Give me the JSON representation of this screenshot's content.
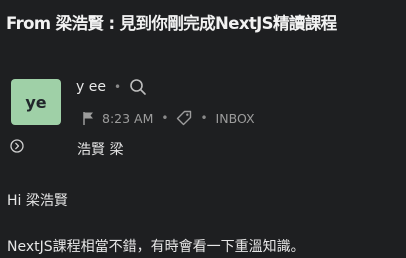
{
  "email": {
    "subject": "From 梁浩賢 : 見到你剛完成NextJS精讀課程",
    "avatar_initials": "ye",
    "avatar_color": "#9fd0a7",
    "sender_name": "y ee",
    "time": "8:23 AM",
    "folder": "INBOX",
    "recipient": "浩賢 梁",
    "greeting": "Hi 梁浩賢",
    "message": "NextJS課程相當不錯，有時會看一下重溫知識。"
  },
  "icons": {
    "search": "search-icon",
    "flag": "flag-icon",
    "tag": "tag-icon",
    "expand": "chevron-right-circle-icon"
  }
}
